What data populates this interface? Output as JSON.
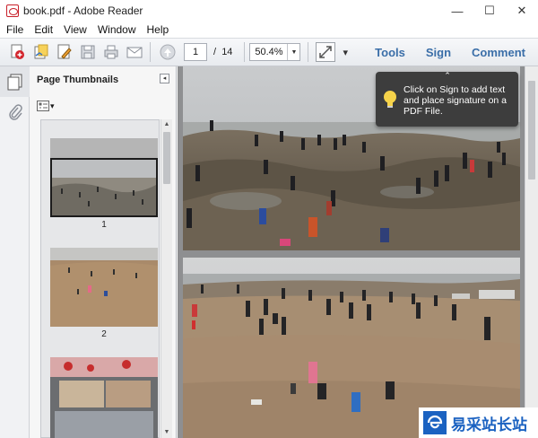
{
  "window": {
    "title": "book.pdf - Adobe Reader",
    "minimize_glyph": "—",
    "maximize_glyph": "☐",
    "close_glyph": "✕"
  },
  "menu": [
    "File",
    "Edit",
    "View",
    "Window",
    "Help"
  ],
  "toolbar": {
    "icons": [
      "create-pdf-icon",
      "open-icon",
      "edit-icon",
      "save-icon",
      "print-icon",
      "email-icon",
      "previous-page-icon"
    ],
    "current_page": "1",
    "page_separator": "/",
    "total_pages": "14",
    "zoom": "50.4%",
    "zoom_arrow": "▼",
    "fit_icon": "fit-page-icon",
    "overflow_glyph": "▾",
    "tools_label": "Tools",
    "sign_label": "Sign",
    "comment_label": "Comment"
  },
  "nav_rail": {
    "icons": [
      "page-thumbnails-icon",
      "attachments-icon"
    ]
  },
  "thumbnail_panel": {
    "title": "Page Thumbnails",
    "collapse_glyph": "◂",
    "options_arrow": "▾",
    "scroll_up": "▲",
    "scroll_down": "▼",
    "thumbnails": [
      {
        "label": "1",
        "selected": true
      },
      {
        "label": "2",
        "selected": false
      },
      {
        "label": ""
      }
    ]
  },
  "callout": {
    "caret": "⌃",
    "text": "Click on Sign to add text and place signature on a PDF File.",
    "icon": "lightbulb-icon"
  },
  "document": {
    "photos": [
      "beach-rocks-crowd-photo",
      "beach-shore-crowd-photo"
    ]
  },
  "watermark": {
    "text": "易采站长站"
  },
  "colors": {
    "accent": "#3a6ea8",
    "callout_bg": "#3d3d3d",
    "watermark_blue": "#1b62c1"
  }
}
